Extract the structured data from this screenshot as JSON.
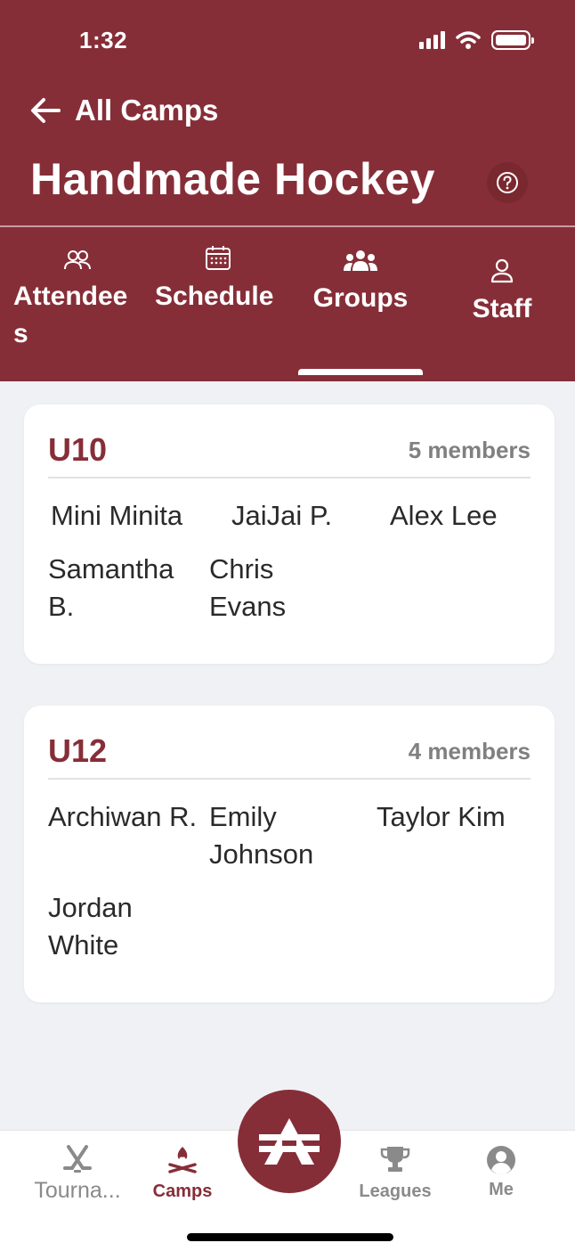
{
  "status_bar": {
    "time": "1:32"
  },
  "header": {
    "back_label": "All Camps",
    "title": "Handmade Hockey",
    "help_icon": "question-circle-icon"
  },
  "tabs": [
    {
      "label": "Attendees",
      "icon": "people-outline-icon"
    },
    {
      "label": "Schedule",
      "icon": "calendar-icon"
    },
    {
      "label": "Groups",
      "icon": "people-filled-icon",
      "active": true
    },
    {
      "label": "Staff",
      "icon": "person-outline-icon"
    }
  ],
  "groups": [
    {
      "name": "U10",
      "count": "5 members",
      "members": [
        "Mini Minita",
        "JaiJai P.",
        "Alex Lee",
        "Samantha B.",
        "Chris Evans"
      ]
    },
    {
      "name": "U12",
      "count": "4 members",
      "members": [
        "Archiwan R.",
        "Emily Johnson",
        "Taylor Kim",
        "Jordan White"
      ]
    }
  ],
  "bottom_nav": {
    "items": [
      {
        "label": "Tourna...",
        "icon": "hockey-sticks-icon"
      },
      {
        "label": "Camps",
        "icon": "campfire-icon",
        "active": true
      },
      {
        "label": "Leagues",
        "icon": "trophy-icon"
      },
      {
        "label": "Me",
        "icon": "user-circle-icon"
      }
    ],
    "center_icon": "app-logo-icon"
  },
  "colors": {
    "brand": "#862e38",
    "background": "#f0f1f5",
    "muted": "#808080",
    "inactive": "#8a8a8a"
  }
}
